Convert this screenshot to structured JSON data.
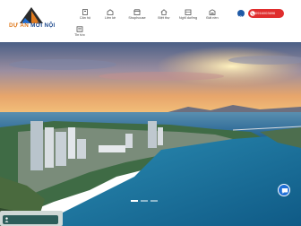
{
  "logo": {
    "text_a": "DỰ ÁN ",
    "text_b": "MỚI NỘI"
  },
  "nav": [
    {
      "label": "Căn hộ",
      "icon": "building-icon"
    },
    {
      "label": "Liền kề",
      "icon": "townhouse-icon"
    },
    {
      "label": "Shophouse",
      "icon": "shop-icon"
    },
    {
      "label": "Biệt thự",
      "icon": "villa-icon"
    },
    {
      "label": "Nghỉ dưỡng",
      "icon": "resort-icon"
    },
    {
      "label": "Đất nền",
      "icon": "land-icon"
    }
  ],
  "nav_secondary": {
    "label": "Tin tức",
    "icon": "news-icon"
  },
  "phone": {
    "number": "0916003696"
  },
  "colors": {
    "brand_orange": "#e07b1f",
    "brand_blue": "#1f4b8f",
    "phone_red": "#e02d2d"
  },
  "hero": {
    "slides_count": 3,
    "active_slide": 1
  },
  "bottom": {
    "label": ""
  }
}
